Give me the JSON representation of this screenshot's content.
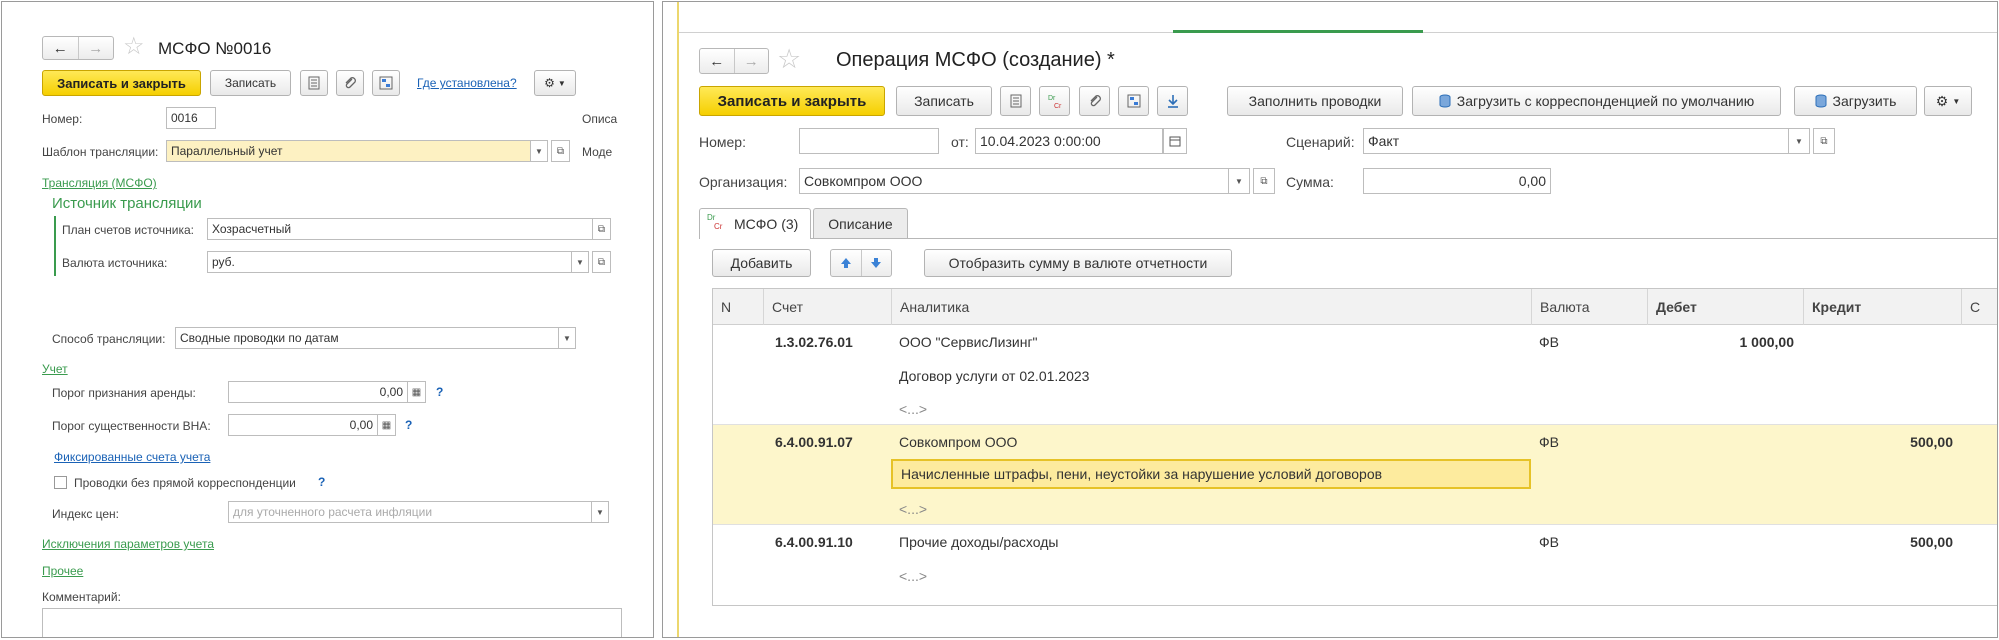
{
  "left": {
    "title": "МСФО №0016",
    "toolbar": {
      "save_close": "Записать и закрыть",
      "save": "Записать",
      "where_link": "Где установлена?"
    },
    "fields": {
      "number_label": "Номер:",
      "number_value": "0016",
      "desc_label": "Описа",
      "template_label": "Шаблон трансляции:",
      "template_value": "Параллельный учет",
      "model_label": "Моде"
    },
    "translation_link": "Трансляция (МСФО)",
    "source_section": {
      "title": "Источник трансляции",
      "plan_label": "План счетов источника:",
      "plan_value": "Хозрасчетный",
      "currency_label": "Валюта источника:",
      "currency_value": "руб."
    },
    "method_label": "Способ трансляции:",
    "method_value": "Сводные проводки по датам",
    "accounting_link": "Учет",
    "lease_label": "Порог признания аренды:",
    "lease_value": "0,00",
    "vna_label": "Порог существенности ВНА:",
    "vna_value": "0,00",
    "fixed_accounts_link": "Фиксированные счета учета",
    "no_corr_label": "Проводки без прямой корреспонденции",
    "price_index_label": "Индекс цен:",
    "price_index_placeholder": "для уточненного расчета инфляции",
    "exclusions_link": "Исключения параметров учета",
    "other_link": "Прочее",
    "comment_label": "Комментарий:",
    "help_mark": "?"
  },
  "right": {
    "title": "Операция МСФО (создание) *",
    "toolbar": {
      "save_close": "Записать и закрыть",
      "save": "Записать",
      "fill": "Заполнить проводки",
      "load_default": "Загрузить с корреспонденцией по умолчанию",
      "load": "Загрузить"
    },
    "number_label": "Номер:",
    "number_value": "",
    "from_label": "от:",
    "date_value": "10.04.2023  0:00:00",
    "scenario_label": "Сценарий:",
    "scenario_value": "Факт",
    "org_label": "Организация:",
    "org_value": "Совкомпром ООО",
    "sum_label": "Сумма:",
    "sum_value": "0,00",
    "tabs": [
      {
        "label": "МСФО (3)",
        "badge_top": "Dr",
        "badge_bottom": "Cr"
      },
      {
        "label": "Описание"
      }
    ],
    "table_toolbar": {
      "add": "Добавить",
      "show_sum": "Отобразить сумму в валюте отчетности"
    },
    "columns": [
      "N",
      "Счет",
      "Аналитика",
      "Валюта",
      "Дебет",
      "Кредит",
      "С"
    ],
    "rows": [
      {
        "account": "1.3.02.76.01",
        "analytics": [
          "ООО \"СервисЛизинг\"",
          "Договор услуги от 02.01.2023",
          "<...>"
        ],
        "currency": "ФВ",
        "debit": "1 000,00",
        "credit": ""
      },
      {
        "account": "6.4.00.91.07",
        "analytics": [
          "Совкомпром ООО",
          "Начисленные штрафы, пени, неустойки за нарушение условий договоров",
          "<...>"
        ],
        "currency": "ФВ",
        "debit": "",
        "credit": "500,00"
      },
      {
        "account": "6.4.00.91.10",
        "analytics": [
          "Прочие доходы/расходы",
          "<...>",
          ""
        ],
        "currency": "ФВ",
        "debit": "",
        "credit": "500,00"
      }
    ]
  },
  "icons": [
    "arrow-left-icon",
    "arrow-right-icon",
    "star-icon",
    "list-icon",
    "paperclip-icon",
    "structure-icon",
    "gear-icon",
    "download-icon",
    "database-icon",
    "calendar-icon",
    "arrow-up-icon",
    "arrow-down-icon",
    "open-icon",
    "dropdown-icon"
  ]
}
